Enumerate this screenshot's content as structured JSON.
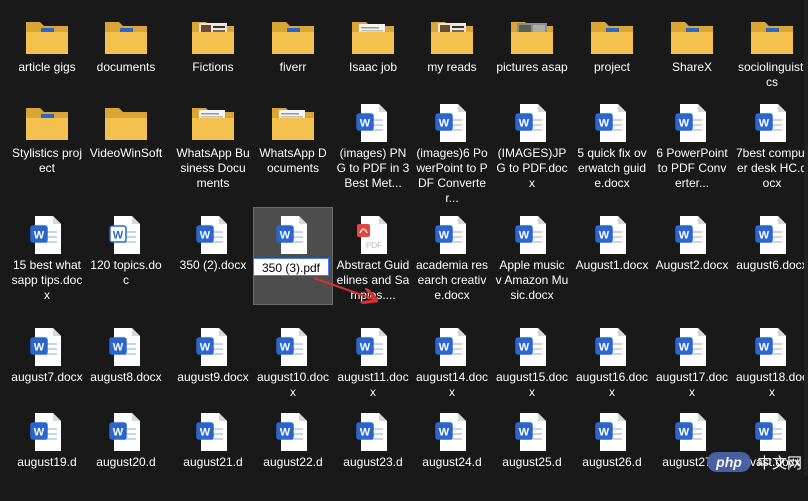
{
  "items": [
    {
      "name": "article gigs",
      "type": "folder",
      "preview": "doc"
    },
    {
      "name": "documents",
      "type": "folder",
      "preview": "doc"
    },
    {
      "name": "Fictions",
      "type": "folder",
      "preview": "book"
    },
    {
      "name": "fiverr",
      "type": "folder",
      "preview": "doc"
    },
    {
      "name": "Isaac job",
      "type": "folder",
      "preview": "page"
    },
    {
      "name": "my reads",
      "type": "folder",
      "preview": "book"
    },
    {
      "name": "pictures asap",
      "type": "folder",
      "preview": "photo"
    },
    {
      "name": "project",
      "type": "folder",
      "preview": "doc"
    },
    {
      "name": "ShareX",
      "type": "folder",
      "preview": "doc"
    },
    {
      "name": "sociolinguistics",
      "type": "folder",
      "preview": "doc"
    },
    {
      "name": "Stylistics project",
      "type": "folder",
      "preview": "doc"
    },
    {
      "name": "VideoWinSoft",
      "type": "folder",
      "preview": "none"
    },
    {
      "name": "WhatsApp Business Documents",
      "type": "folder",
      "preview": "page"
    },
    {
      "name": "WhatsApp Documents",
      "type": "folder",
      "preview": "page"
    },
    {
      "name": "(images) PNG to PDF in 3 Best Met...",
      "type": "word"
    },
    {
      "name": "(images)6 PowerPoint to PDF Converter...",
      "type": "word"
    },
    {
      "name": "(IMAGES)JPG to PDF.docx",
      "type": "word"
    },
    {
      "name": "5 quick fix overwatch guide.docx",
      "type": "word"
    },
    {
      "name": "6 PowerPoint to PDF Converter...",
      "type": "word"
    },
    {
      "name": "7best computer desk HC.docx",
      "type": "word"
    },
    {
      "name": "15 best whatsapp tips.docx",
      "type": "word"
    },
    {
      "name": "120 topics.doc",
      "type": "word-old"
    },
    {
      "name": "350 (2).docx",
      "type": "word"
    },
    {
      "name": "350 (3).pdf",
      "type": "word",
      "selected": true,
      "renaming": true
    },
    {
      "name": "Abstract Guidelines and Samples....",
      "type": "pdf"
    },
    {
      "name": "academia research creative.docx",
      "type": "word"
    },
    {
      "name": "Apple music v Amazon Music.docx",
      "type": "word"
    },
    {
      "name": "August1.docx",
      "type": "word"
    },
    {
      "name": "August2.docx",
      "type": "word"
    },
    {
      "name": "august6.docx",
      "type": "word"
    },
    {
      "name": "august7.docx",
      "type": "word"
    },
    {
      "name": "august8.docx",
      "type": "word"
    },
    {
      "name": "august9.docx",
      "type": "word"
    },
    {
      "name": "august10.docx",
      "type": "word"
    },
    {
      "name": "august11.docx",
      "type": "word"
    },
    {
      "name": "august14.docx",
      "type": "word"
    },
    {
      "name": "august15.docx",
      "type": "word"
    },
    {
      "name": "august16.docx",
      "type": "word"
    },
    {
      "name": "august17.docx",
      "type": "word"
    },
    {
      "name": "august18.docx",
      "type": "word"
    },
    {
      "name": "august19.d",
      "type": "word"
    },
    {
      "name": "august20.d",
      "type": "word"
    },
    {
      "name": "august21.d",
      "type": "word"
    },
    {
      "name": "august22.d",
      "type": "word"
    },
    {
      "name": "august23.d",
      "type": "word"
    },
    {
      "name": "august24.d",
      "type": "word"
    },
    {
      "name": "august25.d",
      "type": "word"
    },
    {
      "name": "august26.d",
      "type": "word"
    },
    {
      "name": "august27.d",
      "type": "word"
    },
    {
      "name": "avast.docx",
      "type": "word"
    }
  ],
  "icons": {
    "folder": "folder-icon",
    "word": "word-document-icon",
    "pdf": "pdf-document-icon"
  },
  "colors": {
    "background": "#191919",
    "folder": "#f4c04e",
    "word_blue": "#2b66cf",
    "pdf_red": "#e0473f",
    "arrow": "#d93030"
  },
  "watermark": {
    "logo": "php",
    "text": "中文网"
  }
}
